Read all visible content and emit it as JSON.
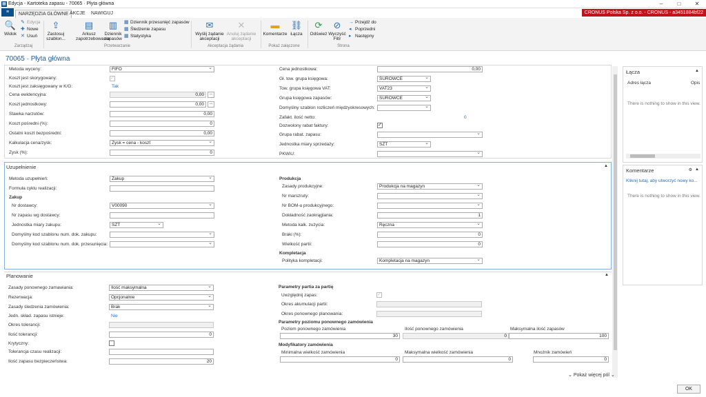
{
  "window": {
    "title": "Edycja - Kartoteka zapasu - 70065 · Płyta główna",
    "app_icon": "app-icon",
    "minimize": "–",
    "maximize": "□",
    "close": "✕"
  },
  "menu": {
    "tabs": [
      "NARZĘDZIA GŁÓWNE",
      "AKCJE",
      "NAWIGUJ"
    ],
    "active": 0,
    "company": "CRONUS Polska Sp. z o.o. - CRONUS - a3451884bf22",
    "menu_icon": "≡"
  },
  "ribbon": {
    "widok": "Widok",
    "edycja": "Edycja",
    "nowe": "Nowe",
    "usun": "Usuń",
    "zastosuj": "Zastosuj szablon...",
    "arkusz": "Arkusz zapotrzebowania",
    "dziennik": "Dziennik zapasów",
    "dziennik_przes": "Dziennik przesunięć zapasów",
    "sledzenie": "Śledzenie zapasu",
    "statystyka": "Statystyka",
    "wyslij": "Wyślij żądanie akceptacji",
    "anuluj": "Anuluj żądanie akceptacji",
    "komentarze": "Komentarze",
    "lacza": "Łącza",
    "odswiez": "Odśwież",
    "wyczysc": "Wyczyść Filtr",
    "przejdz": "Przejdź do",
    "poprzedni": "Poprzedni",
    "nastepny": "Następny",
    "g_zarzadzaj": "Zarządzaj",
    "g_przetwarzanie": "Przetwarzanie",
    "g_akceptacja": "Akceptacja żądania",
    "g_pokaz": "Pokaż załączone",
    "g_strona": "Strona"
  },
  "page_title": "70065 · Płyta główna",
  "koszty": {
    "metoda_wyceny_l": "Metoda wyceny:",
    "metoda_wyceny": "FIFO",
    "koszt_skoryg_l": "Koszt jest skorygowany:",
    "koszt_zaksieg_l": "Koszt jest zaksięgowany w K/G:",
    "koszt_zaksieg": "Tak",
    "cena_ewid_l": "Cena ewidencyjna:",
    "cena_ewid": "0,00",
    "koszt_jedn_l": "Koszt jednostkowy:",
    "koszt_jedn": "0,00",
    "stawka_l": "Stawka narzutów:",
    "stawka": "0,00",
    "koszt_posr_l": "Koszt pośredni (%):",
    "koszt_posr": "0",
    "ostatni_l": "Ostatni koszt bezpośredni:",
    "ostatni": "0,00",
    "kalkulacja_l": "Kalkulacja cena/zysk:",
    "kalkulacja": "Zysk = cena - koszt",
    "zysk_l": "Zysk (%):",
    "zysk": "0",
    "cena_jedn_l": "Cena jednostkowa:",
    "cena_jedn": "0,00",
    "gl_tow_l": "Gł. tow. grupa księgowa:",
    "gl_tow": "SUROWCE",
    "tow_vat_l": "Tow. grupa księgowa VAT:",
    "tow_vat": "VAT23",
    "grupa_zap_l": "Grupa księgowa zapasów:",
    "grupa_zap": "SUROWCE",
    "domyslny_szablon_l": "Domyślny szablon rozliczeń międzyokresowych:",
    "zafakt_l": "Zafakt. ilość netto:",
    "zafakt": "0",
    "dozwolony_l": "Dozwolony rabat faktury:",
    "grupa_rabat_l": "Grupa rabat. zapasu:",
    "jedn_sprz_l": "Jednostka miary sprzedaży:",
    "jedn_sprz": "SZT",
    "pkwiu_l": "PKWiU:"
  },
  "uzupelnienie": {
    "title": "Uzupełnienie",
    "metoda_l": "Metoda uzupełnień:",
    "metoda": "Zakup",
    "formula_l": "Formuła cyklu realizacji:",
    "zakup": "Zakup",
    "nr_dost_l": "Nr dostawcy:",
    "nr_dost": "V00090",
    "nr_zap_l": "Nr zapasu wg dostawcy:",
    "jedn_zak_l": "Jednostka miary zakupu:",
    "jedn_zak": "SZT",
    "kod_zak_l": "Domyślny kod szablonu num. dok. zakupu:",
    "kod_przes_l": "Domyślny kod szablonu num. dok. przesunięcia:",
    "produkcja": "Produkcja",
    "zasady_l": "Zasady produkcyjne:",
    "zasady": "Produkcja na magazyn",
    "nr_marsz_l": "Nr marszruty:",
    "nr_bom_l": "Nr BOM-u produkcyjnego:",
    "dokl_l": "Dokładność zaokrąglania:",
    "dokl": "1",
    "metoda_kalk_l": "Metoda kalk. zużycia:",
    "metoda_kalk": "Ręczna",
    "braki_l": "Braki (%):",
    "braki": "0",
    "wielkosc_l": "Wielkość partii:",
    "wielkosc": "0",
    "kompletacja": "Kompletacja",
    "polityka_l": "Polityka kompletacji:",
    "polityka": "Kompletacja na magazyn"
  },
  "planowanie": {
    "title": "Planowanie",
    "zasady_l": "Zasady ponownego zamawiania:",
    "zasady": "Ilość maksymalna",
    "rezerwacja_l": "Rezerwacja:",
    "rezerwacja": "Opcjonalnie",
    "sledzenie_l": "Zasady śledzenia zamówienia:",
    "sledzenie": "Brak",
    "jedn_skl_l": "Jedn. skład. zapasu istnieje:",
    "jedn_skl": "Nie",
    "okres_tol_l": "Okres tolerancji:",
    "ilosc_tol_l": "Ilość tolerancji:",
    "ilosc_tol": "0",
    "krytyczny_l": "Krytyczny:",
    "tol_czasu_l": "Tolerancja czasu realizacji:",
    "bezp_l": "Ilość zapasu bezpieczeństwa:",
    "bezp": "20",
    "partia_head": "Parametry partia za partię",
    "uwzgl_l": "Uwzględnij zapas:",
    "okres_akum_l": "Okres akumulacji partii:",
    "okres_pon_l": "Okres ponownego planowania:",
    "poziom_head": "Parametry poziomu ponownego zamówienia",
    "poziom_l": "Poziom ponownego zamówienia",
    "poziom": "30",
    "ilosc_pon_l": "Ilość ponownego zamówienia",
    "ilosc_pon": "0",
    "max_zap_l": "Maksymalna ilość zapasów",
    "max_zap": "100",
    "modyf_head": "Modyfikatory zamówienia",
    "min_l": "Minimalna wielkość zamówienia",
    "min": "0",
    "max_l": "Maksymalna wielkość zamówienia",
    "max": "0",
    "mnoznik_l": "Mnożnik zamówień",
    "mnoznik": "0"
  },
  "factbox_lacza": {
    "title": "Łącza",
    "col1": "Adres łącza",
    "col2": "Opis",
    "empty": "There is nothing to show in this view."
  },
  "factbox_koment": {
    "title": "Komentarze",
    "link": "Kliknij tutaj, aby utworzyć nowy ko...",
    "empty": "There is nothing to show in this view."
  },
  "more_fields": "Pokaż więcej pól",
  "ok": "OK"
}
